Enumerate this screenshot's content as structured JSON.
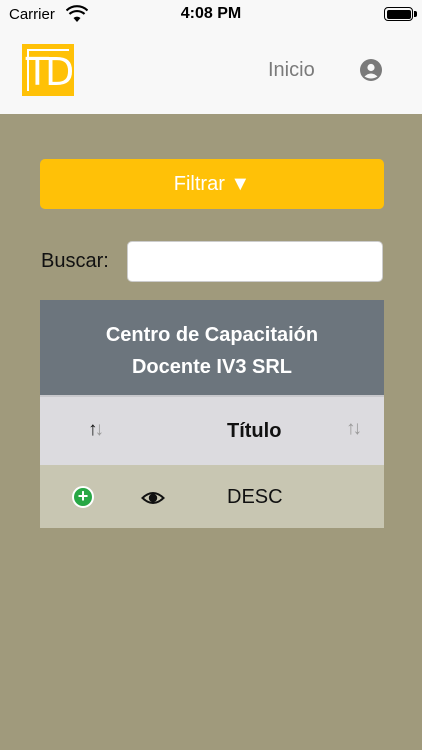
{
  "status_bar": {
    "carrier": "Carrier",
    "time": "4:08 PM"
  },
  "navbar": {
    "logo_text": "TD",
    "home_link": "Inicio"
  },
  "filter": {
    "button_label": "Filtrar ▼"
  },
  "search": {
    "label": "Buscar:",
    "value": ""
  },
  "table": {
    "caption": "Centro de Capacitaión Docente IV3 SRL",
    "column_title": "Título",
    "rows": [
      {
        "title": "DESC"
      }
    ]
  },
  "colors": {
    "accent": "#ffc107",
    "background": "#a09a7c",
    "caption_bg": "#6c757d",
    "add_green": "#28a745"
  }
}
